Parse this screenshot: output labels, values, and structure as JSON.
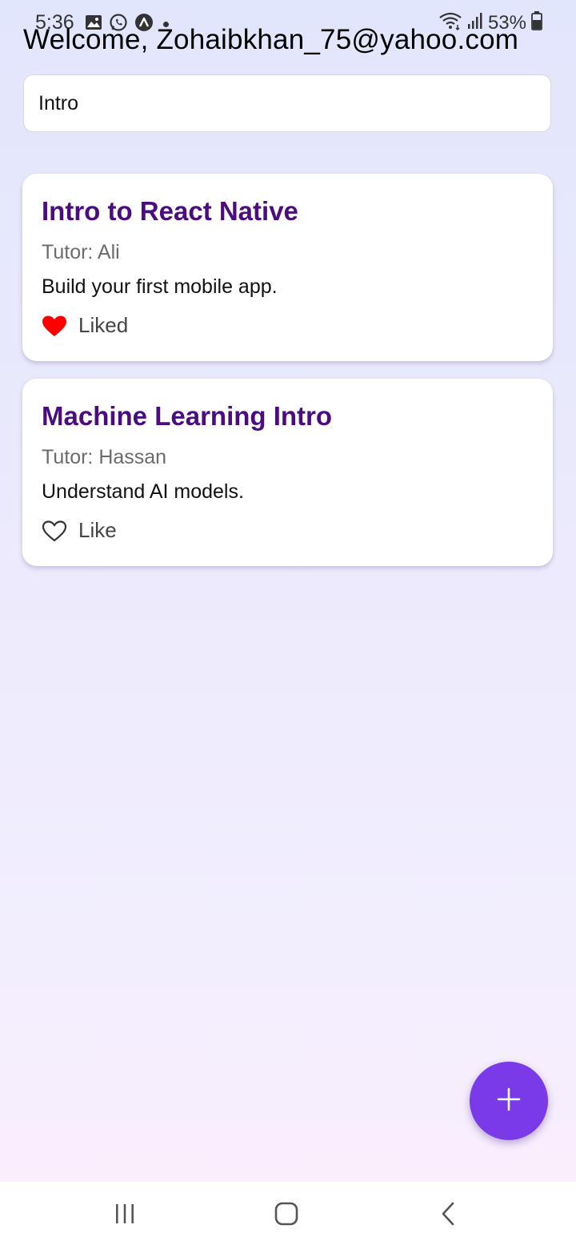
{
  "status_bar": {
    "time": "5:36",
    "battery": "53%",
    "icons": [
      "gallery-icon",
      "whatsapp-icon",
      "app-icon",
      "notification-dot",
      "wifi-icon",
      "signal-icon",
      "battery-icon"
    ]
  },
  "header": {
    "welcome": "Welcome, Zohaibkhan_75@yahoo.com"
  },
  "search": {
    "value": "Intro"
  },
  "courses": [
    {
      "title": "Intro to React Native",
      "tutor": "Tutor: Ali",
      "description": "Build your first mobile app.",
      "like_label": "Liked",
      "liked": true
    },
    {
      "title": "Machine Learning Intro",
      "tutor": "Tutor: Hassan",
      "description": "Understand AI models.",
      "like_label": "Like",
      "liked": false
    }
  ],
  "fab": {
    "icon": "plus-icon"
  },
  "nav_bar": {
    "icons": [
      "recent-apps-icon",
      "home-icon",
      "back-icon"
    ]
  },
  "colors": {
    "accent": "#7b3ae8",
    "title": "#4b0c7f",
    "liked_heart": "#ff0000"
  }
}
